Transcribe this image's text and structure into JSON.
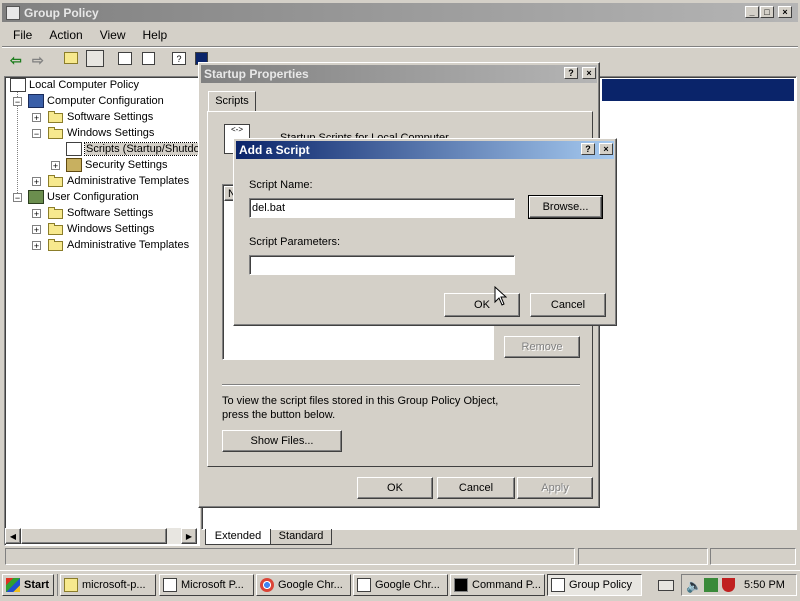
{
  "main_window": {
    "title": "Group Policy",
    "menu": [
      "File",
      "Action",
      "View",
      "Help"
    ]
  },
  "tree": {
    "items": [
      {
        "label": "Local Computer Policy",
        "level": 0
      },
      {
        "label": "Computer Configuration",
        "level": 1,
        "expander": "-"
      },
      {
        "label": "Software Settings",
        "level": 2,
        "expander": "+"
      },
      {
        "label": "Windows Settings",
        "level": 2,
        "expander": "-"
      },
      {
        "label": "Scripts (Startup/Shutdown)",
        "level": 3
      },
      {
        "label": "Security Settings",
        "level": 3,
        "expander": "+"
      },
      {
        "label": "Administrative Templates",
        "level": 2,
        "expander": "+"
      },
      {
        "label": "User Configuration",
        "level": 1,
        "expander": "-"
      },
      {
        "label": "Software Settings",
        "level": 2,
        "expander": "+"
      },
      {
        "label": "Windows Settings",
        "level": 2,
        "expander": "+"
      },
      {
        "label": "Administrative Templates",
        "level": 2,
        "expander": "+"
      }
    ]
  },
  "view_tabs": [
    "Extended",
    "Standard"
  ],
  "startup_dialog": {
    "title": "Startup Properties",
    "tab": "Scripts",
    "heading": "Startup Scripts for Local Computer",
    "list_header": "N",
    "remove_label": "Remove",
    "info_text": "To view the script files stored in this Group Policy Object, press the button below.",
    "show_files_label": "Show Files...",
    "ok_label": "OK",
    "cancel_label": "Cancel",
    "apply_label": "Apply"
  },
  "add_script_dialog": {
    "title": "Add a Script",
    "script_name_label": "Script Name:",
    "script_name_value": "del.bat",
    "browse_label": "Browse...",
    "script_params_label": "Script Parameters:",
    "script_params_value": "",
    "ok_label": "OK",
    "cancel_label": "Cancel"
  },
  "taskbar": {
    "start_label": "Start",
    "tasks": [
      {
        "label": "microsoft-p...",
        "icon": "folder-icon"
      },
      {
        "label": "Microsoft P...",
        "icon": "app-icon"
      },
      {
        "label": "Google Chr...",
        "icon": "chrome-icon"
      },
      {
        "label": "Google Chr...",
        "icon": "app-icon"
      },
      {
        "label": "Command P...",
        "icon": "cmd-icon"
      },
      {
        "label": "Group Policy",
        "icon": "policy-icon"
      }
    ],
    "clock": "5:50 PM"
  },
  "colors": {
    "active_title": "#0a246a",
    "face": "#d4d0c8"
  }
}
